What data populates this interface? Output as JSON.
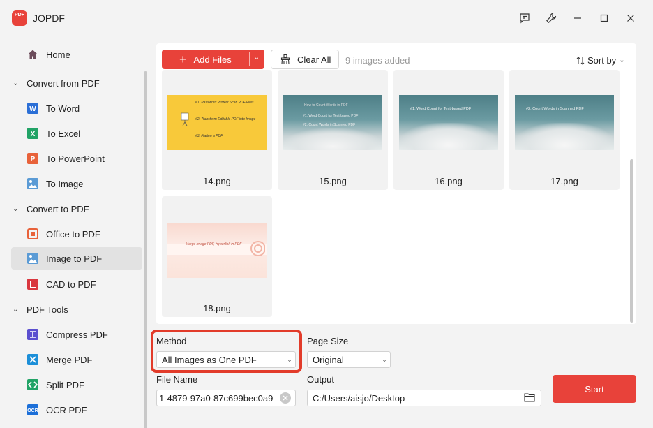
{
  "app": {
    "title": "JOPDF",
    "logo_text": "PDF"
  },
  "sidebar": {
    "home": "Home",
    "groups": [
      {
        "label": "Convert from PDF",
        "items": [
          "To Word",
          "To Excel",
          "To PowerPoint",
          "To Image"
        ]
      },
      {
        "label": "Convert to PDF",
        "items": [
          "Office to PDF",
          "Image to PDF",
          "CAD to PDF"
        ]
      },
      {
        "label": "PDF Tools",
        "items": [
          "Compress PDF",
          "Merge PDF",
          "Split PDF",
          "OCR PDF"
        ]
      }
    ],
    "active_item": "Image to PDF"
  },
  "toolbar": {
    "add_files": "Add Files",
    "clear_all": "Clear All",
    "count": "9 images added",
    "sort_by": "Sort by"
  },
  "files": [
    {
      "name": "14.png",
      "lines": [
        "#1. Password Protect Scan PDF Files",
        "#2. Transform Editable PDF into Image",
        "#3. Flatten a PDF"
      ]
    },
    {
      "name": "15.png",
      "lines": [
        "How to Count Words in PDF",
        "#1. Word Count for Text-based PDF",
        "#2. Count Words in Scanned PDF"
      ]
    },
    {
      "name": "16.png",
      "lines": [
        "#1. Word Count for Text-based PDF"
      ]
    },
    {
      "name": "17.png",
      "lines": [
        "#2. Count Words in Scanned PDF"
      ]
    },
    {
      "name": "18.png",
      "lines": [
        "Merge Image PDF, Hyperlink in PDF"
      ]
    }
  ],
  "form": {
    "method_label": "Method",
    "method_value": "All Images as One PDF",
    "page_size_label": "Page Size",
    "page_size_value": "Original",
    "file_name_label": "File Name",
    "file_name_value": "1-4879-97a0-87c699bec0a9",
    "output_label": "Output",
    "output_value": "C:/Users/aisjo/Desktop",
    "start": "Start"
  },
  "colors": {
    "accent": "#e8423a",
    "highlight": "#e23b2a"
  }
}
